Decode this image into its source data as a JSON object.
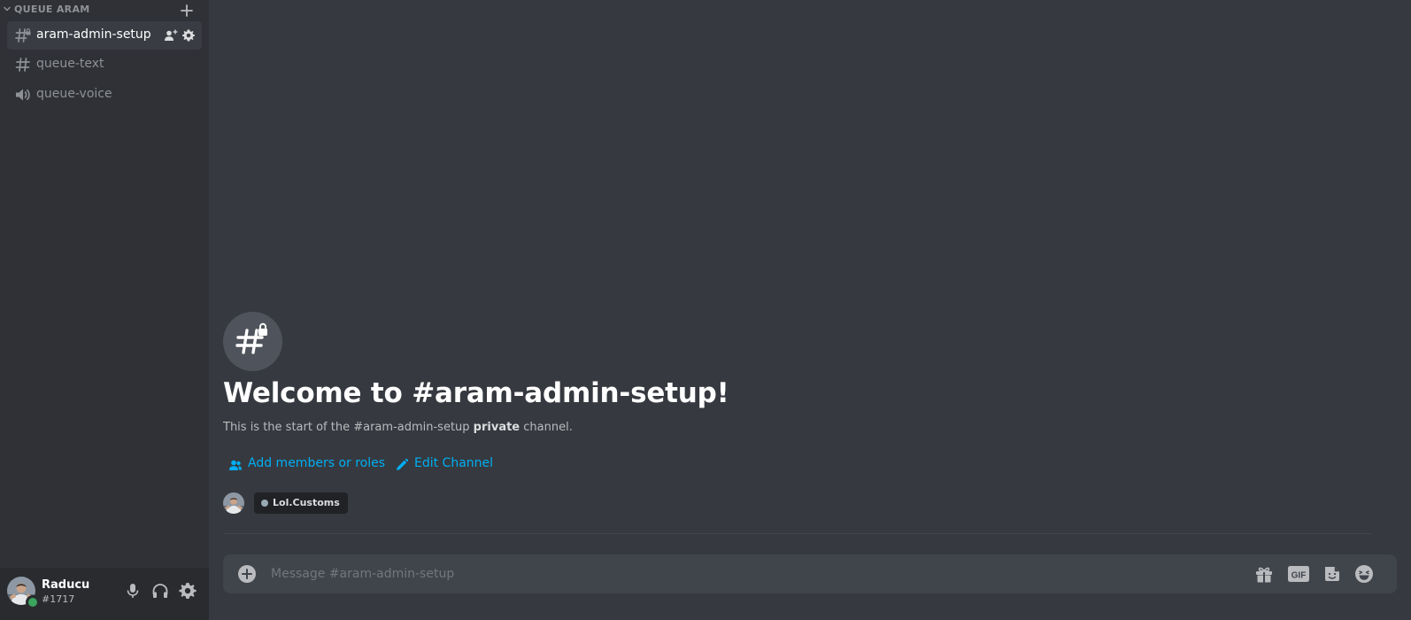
{
  "sidebar": {
    "category": {
      "label": "QUEUE ARAM",
      "icon": "chevron-down-icon",
      "add_icon": "plus-icon"
    },
    "channels": [
      {
        "name": "aram-admin-setup",
        "type": "text-private",
        "icon": "hashtag-lock-icon",
        "active": true,
        "actions": [
          "add-member-icon",
          "gear-icon"
        ]
      },
      {
        "name": "queue-text",
        "type": "text",
        "icon": "hashtag-icon",
        "active": false
      },
      {
        "name": "queue-voice",
        "type": "voice",
        "icon": "speaker-icon",
        "active": false
      }
    ],
    "user_panel": {
      "username": "Raducu",
      "tag": "#1717",
      "status": "online",
      "controls": [
        "microphone-icon",
        "headphones-icon",
        "gear-icon"
      ]
    }
  },
  "main": {
    "welcome": {
      "icon": "hashtag-lock-icon",
      "title": "Welcome to #aram-admin-setup!",
      "subtitle_prefix": "This is the start of the #aram-admin-setup",
      "subtitle_bold": "private",
      "subtitle_suffix": "channel."
    },
    "actions": [
      {
        "label": "Add members or roles",
        "icon": "add-member-icon"
      },
      {
        "label": "Edit Channel",
        "icon": "pencil-icon"
      }
    ],
    "member_role": {
      "role": "Lol.Customs",
      "role_color": "#99aab5"
    },
    "composer": {
      "placeholder": "Message #aram-admin-setup",
      "value": "",
      "buttons": [
        "gift-icon",
        "gif-icon",
        "sticker-icon",
        "emoji-icon"
      ]
    }
  },
  "colors": {
    "sidebar_bg": "#2f3136",
    "main_bg": "#36393f",
    "user_panel_bg": "#292b2f",
    "link": "#00aff4",
    "online": "#3ba55d"
  }
}
